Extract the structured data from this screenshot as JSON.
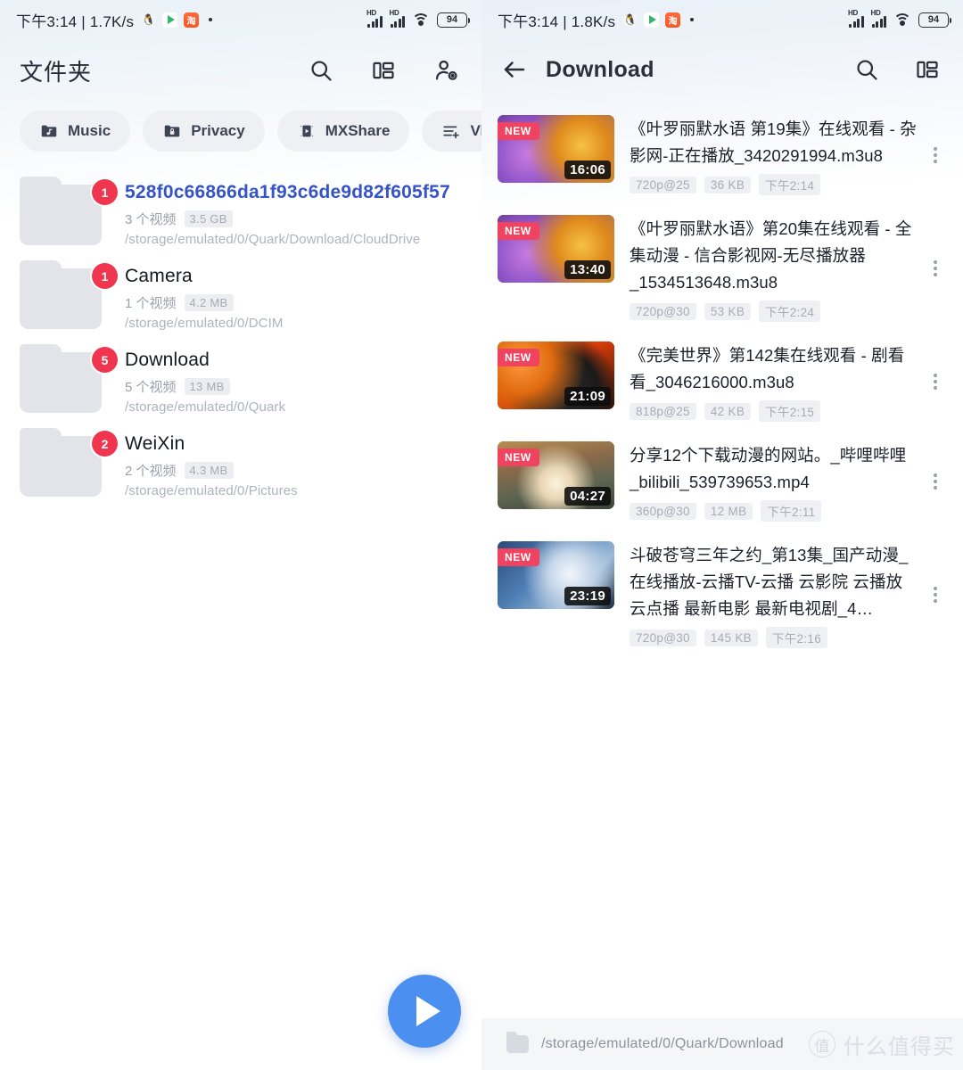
{
  "left": {
    "status": {
      "time_speed": "下午3:14 | 1.7K/s",
      "icons": [
        "qq-icon",
        "play-store-icon",
        "taobao-icon"
      ],
      "battery": "94",
      "signal_label": "HD"
    },
    "header": {
      "title": "文件夹",
      "icons": [
        "search-icon",
        "layout-icon",
        "account-icon"
      ]
    },
    "chips": [
      {
        "label": "Music",
        "icon": "folder-music-icon"
      },
      {
        "label": "Privacy",
        "icon": "folder-lock-icon"
      },
      {
        "label": "MXShare",
        "icon": "mxshare-icon"
      },
      {
        "label": "Video l",
        "icon": "video-list-add-icon"
      }
    ],
    "folders": [
      {
        "badge": "1",
        "name": "528f0c66866da1f93c6de9d82f605f57",
        "highlight": true,
        "count": "3 个视频",
        "size": "3.5 GB",
        "path": "/storage/emulated/0/Quark/Download/CloudDrive"
      },
      {
        "badge": "1",
        "name": "Camera",
        "highlight": false,
        "count": "1 个视频",
        "size": "4.2 MB",
        "path": "/storage/emulated/0/DCIM"
      },
      {
        "badge": "5",
        "name": "Download",
        "highlight": false,
        "count": "5 个视频",
        "size": "13 MB",
        "path": "/storage/emulated/0/Quark"
      },
      {
        "badge": "2",
        "name": "WeiXin",
        "highlight": false,
        "count": "2 个视频",
        "size": "4.3 MB",
        "path": "/storage/emulated/0/Pictures"
      }
    ],
    "fab": {
      "icon": "play-icon",
      "color": "#4b8ff0"
    }
  },
  "right": {
    "status": {
      "time_speed": "下午3:14 | 1.8K/s",
      "icons": [
        "qq-icon",
        "play-store-icon",
        "taobao-icon"
      ],
      "battery": "94",
      "signal_label": "HD"
    },
    "header": {
      "back": "back-arrow-icon",
      "title": "Download",
      "icons": [
        "search-icon",
        "layout-icon"
      ]
    },
    "videos": [
      {
        "tag": "NEW",
        "duration": "16:06",
        "title": "《叶罗丽默水语 第19集》在线观看 - 杂影网-正在播放_3420291994.m3u8",
        "quality": "720p@25",
        "size": "36 KB",
        "time": "下午2:14"
      },
      {
        "tag": "NEW",
        "duration": "13:40",
        "title": "《叶罗丽默水语》第20集在线观看 - 全集动漫 - 信合影视网-无尽播放器_1534513648.m3u8",
        "quality": "720p@30",
        "size": "53 KB",
        "time": "下午2:24"
      },
      {
        "tag": "NEW",
        "duration": "21:09",
        "title": "《完美世界》第142集在线观看 - 剧看看_3046216000.m3u8",
        "quality": "818p@25",
        "size": "42 KB",
        "time": "下午2:15"
      },
      {
        "tag": "NEW",
        "duration": "04:27",
        "title": "分享12个下载动漫的网站。_哔哩哔哩_bilibili_539739653.mp4",
        "quality": "360p@30",
        "size": "12 MB",
        "time": "下午2:11"
      },
      {
        "tag": "NEW",
        "duration": "23:19",
        "title": "斗破苍穹三年之约_第13集_国产动漫_在线播放-云播TV-云播 云影院 云播放 云点播 最新电影 最新电视剧_4…",
        "quality": "720p@30",
        "size": "145 KB",
        "time": "下午2:16"
      }
    ],
    "pathbar": {
      "icon": "folder-icon",
      "path": "/storage/emulated/0/Quark/Download",
      "watermark_badge": "值",
      "watermark_text": "什么值得买"
    }
  }
}
